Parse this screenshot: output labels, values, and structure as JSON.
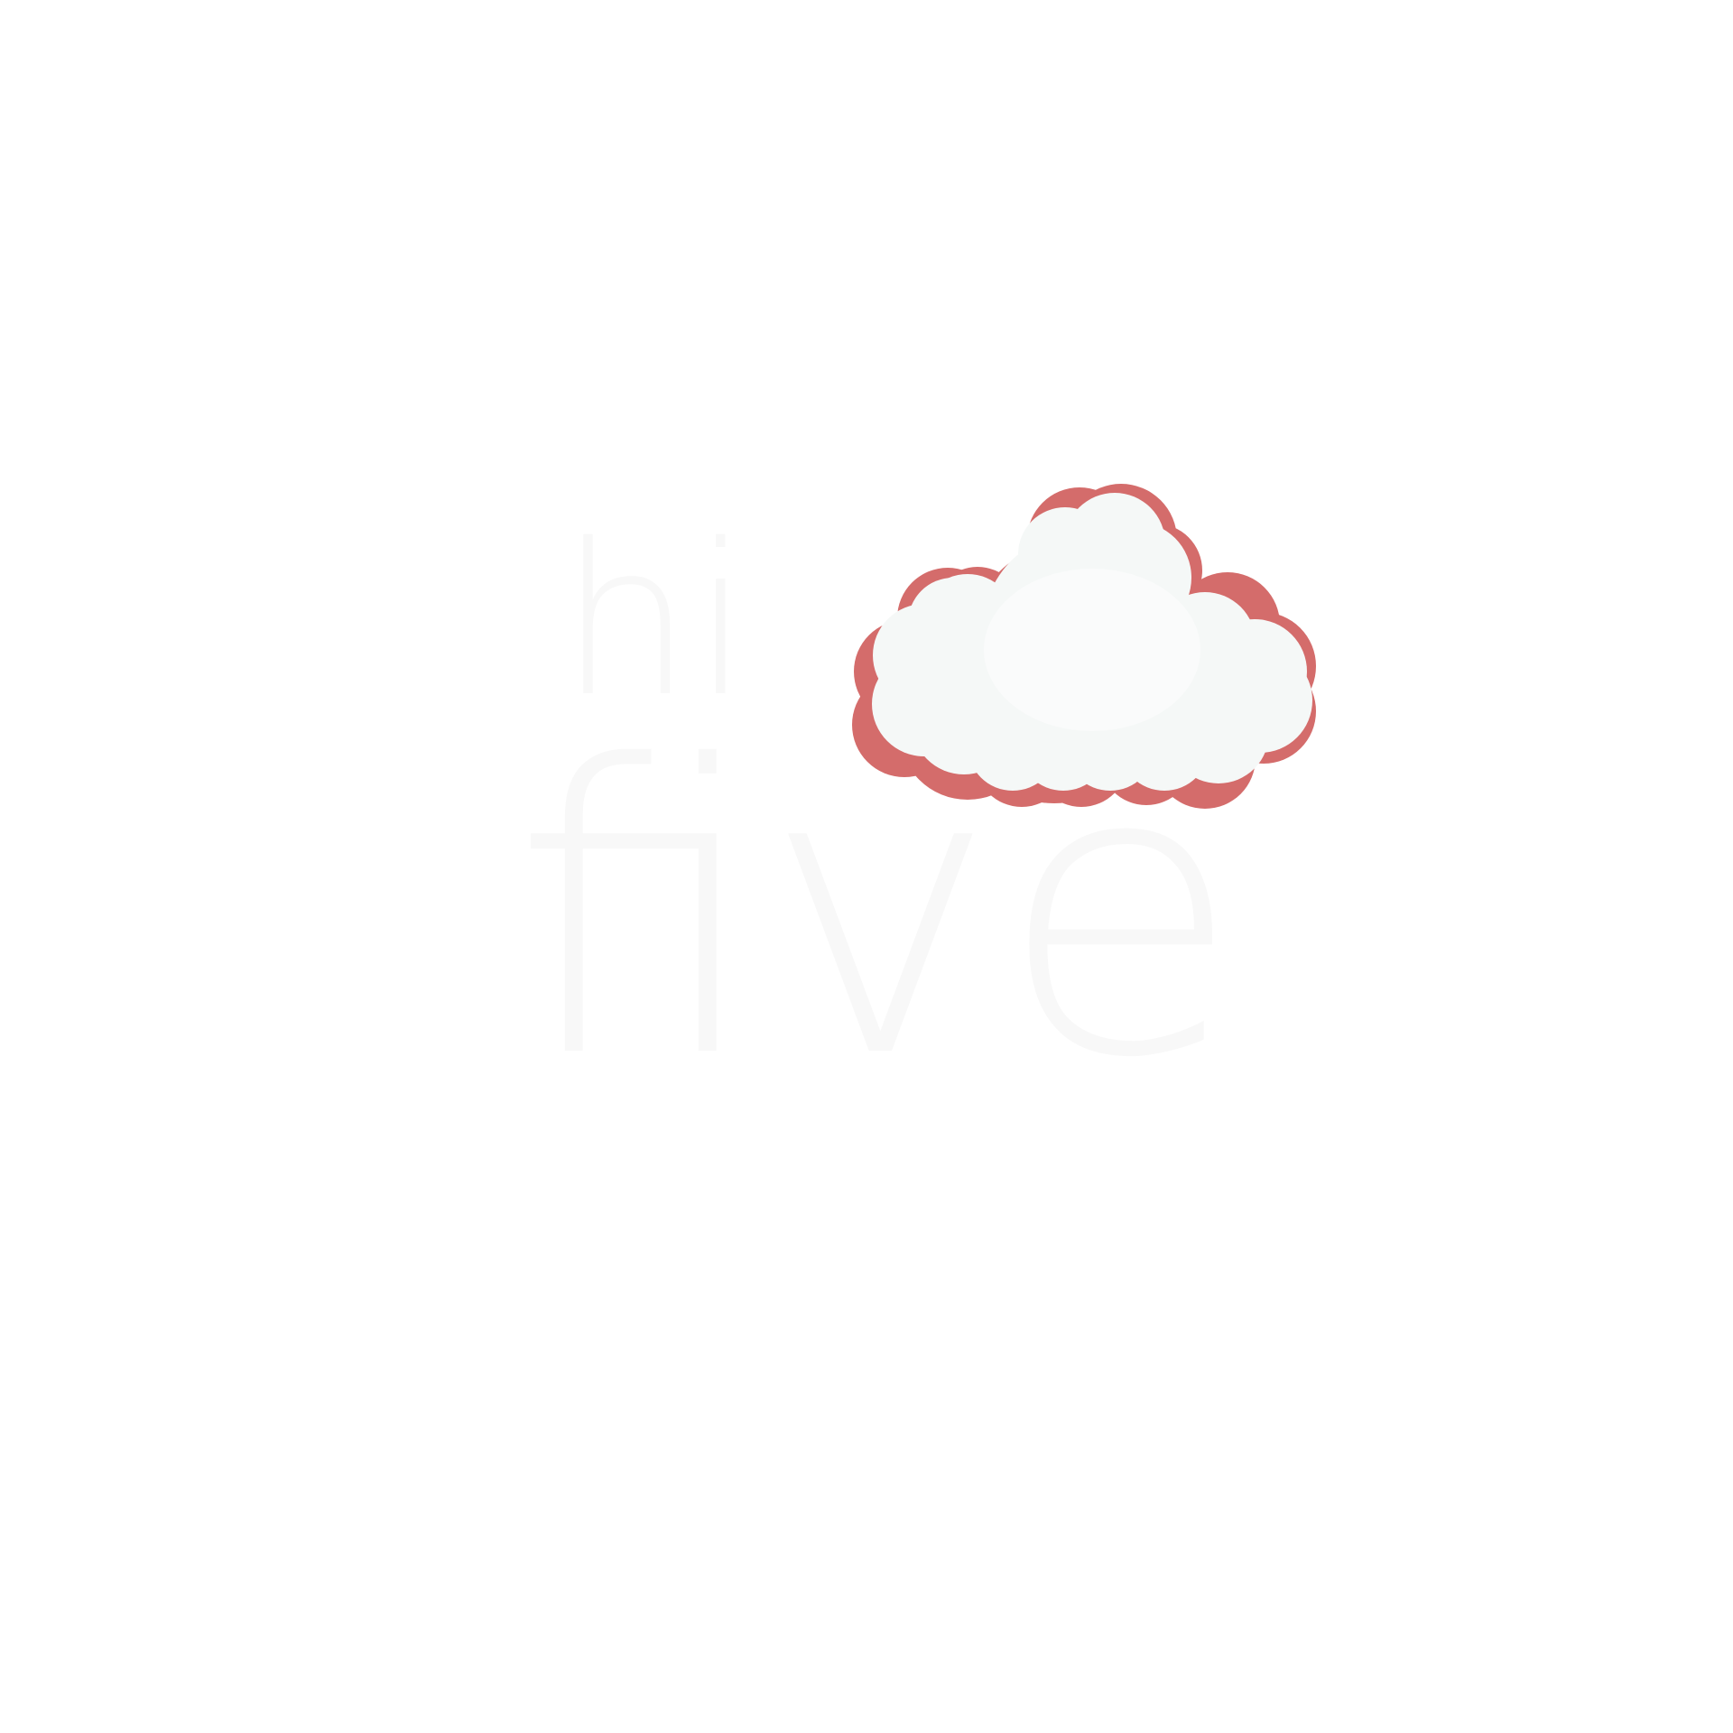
{
  "logo": {
    "word_small": "hi",
    "word_large": "five",
    "colors": {
      "background": "#ffffff",
      "lettering": "#f8f8f8",
      "cloud_shadow": "#d46c6b",
      "cloud_fill": "#f5f8f7",
      "cloud_highlight": "#fafbfb"
    }
  }
}
